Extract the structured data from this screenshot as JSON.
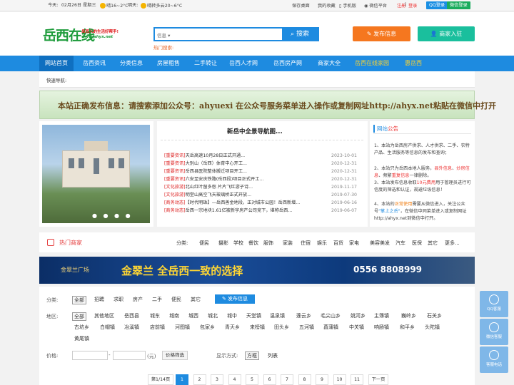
{
  "topbar": {
    "today_label": "今天:",
    "today_text": "02月26日 星期三",
    "weather_today": "晴16~2°C",
    "tomorrow_label": "明天:",
    "weather_tomorrow": "晴转多云20~6°C",
    "links": [
      "保存桌面",
      "我的收藏",
      "手机版",
      "微信平台"
    ],
    "register": "注册",
    "login": "登录",
    "qq_login": "QQ登录",
    "wechat_login": "微信登录"
  },
  "header": {
    "logo_text": "岳西在线",
    "logo_slogan": "岳西人的生活好帮手!",
    "logo_url": "www.ahyx.net",
    "search_select": "信息",
    "search_button": "搜索",
    "hot_search": "热门搜索:",
    "publish_button": "发布信息",
    "merchant_button": "商家入驻"
  },
  "nav": {
    "items": [
      "网站首页",
      "岳西资讯",
      "分类信息",
      "房屋租售",
      "二手转让",
      "岳西人才网",
      "岳西房产网",
      "商家大全",
      "岳西在线家园",
      "惠岳西"
    ]
  },
  "quick_nav": {
    "label": "快速导航:"
  },
  "banner1": {
    "text": "本站正确发布信息：请搜索添加公众号：ahyuexi  在公众号服务菜单进入操作或复制网址http://ahyx.net粘贴在微信中打开"
  },
  "news": {
    "title": "新岳中全景导航图...",
    "items": [
      {
        "cat": "[重要资讯]",
        "text": "天岳高速10月28日正式开通...",
        "date": "2023-10-01"
      },
      {
        "cat": "[重要资讯]",
        "text": "大别山（岳西）体育中心开工...",
        "date": "2020-12-31"
      },
      {
        "cat": "[重要资讯]",
        "text": "岳西县医院整体搬迁项目开工...",
        "date": "2020-12-31"
      },
      {
        "cat": "[重要资讯]",
        "text": "六安至安庆铁路(岳西段)项目正式开工...",
        "date": "2020-12-31"
      },
      {
        "cat": "[文化旅游]",
        "text": "北山红叶留多愁    片片飞红游子诗...",
        "date": "2019-11-17"
      },
      {
        "cat": "[文化旅游]",
        "text": "明堂山高空飞天玻璃桥正式开放...",
        "date": "2019-07-30"
      },
      {
        "cat": "[商务动态]",
        "text": "【时代明珠】—岳西善金地段，正对城市公园！岳西新增...",
        "date": "2019-06-16"
      },
      {
        "cat": "[商务动态]",
        "text": "岳西一宗地块1.61亿被新宇房产公司竞下，堪称岳西...",
        "date": "2019-06-07"
      }
    ]
  },
  "notice": {
    "title_a": "网站",
    "title_b": "公告",
    "lines": [
      {
        "parts": [
          {
            "t": "1、本站为岳西房产供求、人才供求、二手、农特产品、生活服务等信息的发布和查询；",
            "c": ""
          }
        ]
      },
      {
        "parts": [
          {
            "t": "2、本站只为岳西本地人服务，",
            "c": ""
          },
          {
            "t": "县外信息",
            "c": "r"
          },
          {
            "t": "、",
            "c": ""
          },
          {
            "t": "炒房信息",
            "c": "r"
          },
          {
            "t": "、频繁",
            "c": ""
          },
          {
            "t": "重复信息",
            "c": "r"
          },
          {
            "t": "一律删除。",
            "c": ""
          }
        ]
      },
      {
        "parts": [
          {
            "t": "3、本站发布信息收取",
            "c": ""
          },
          {
            "t": "10元费用",
            "c": "r"
          },
          {
            "t": "用于管理员进行可信度的筛选和认证，规避垃圾信息！",
            "c": ""
          }
        ]
      },
      {
        "parts": [
          {
            "t": "4、本站的",
            "c": ""
          },
          {
            "t": "正常使用",
            "c": "o"
          },
          {
            "t": "需要从微信进入，关注公众号",
            "c": ""
          },
          {
            "t": "\"掌上之岳\"",
            "c": "b"
          },
          {
            "t": "，在微信中同菜单进入或复制网址http://ahyx.net到微信中打开。",
            "c": ""
          }
        ]
      }
    ]
  },
  "shops": {
    "title": "热门商家",
    "categories": [
      "分类:",
      "便民",
      "摄影",
      "学校",
      "餐饮",
      "服饰",
      "家装",
      "住宿",
      "娱乐",
      "百货",
      "家电",
      "美容美发",
      "汽车",
      "医保",
      "其它",
      "更多..."
    ]
  },
  "banner2": {
    "brand": "金翠兰广场",
    "slogan": "金翠兰 全岳西一致的选择",
    "phone": "0556 8808999"
  },
  "filter": {
    "category_label": "分类:",
    "categories": [
      "全部",
      "招聘",
      "求职",
      "房产",
      "二手",
      "便民",
      "其它"
    ],
    "publish": "发布信息",
    "area_label": "地区:",
    "areas_row1": [
      "全部",
      "其他地区",
      "岳西县",
      "城东",
      "城南",
      "城西",
      "城北",
      "城中",
      "天堂镇",
      "温泉镇",
      "莲云乡",
      "毛尖山乡",
      "姚河乡",
      "主簿镇",
      "巍岭乡",
      "石关乡"
    ],
    "areas_row2": [
      "古坊乡",
      "白帽镇",
      "冶溪镇",
      "店前镇",
      "河图镇",
      "包家乡",
      "青天乡",
      "来榜镇",
      "田头乡",
      "五河镇",
      "菖蒲镇",
      "中关镇",
      "响肠镇",
      "和平乡",
      "头陀镇"
    ],
    "areas_row3": [
      "黄尾镇"
    ],
    "price_label": "价格:",
    "price_sep": "-",
    "price_unit": "(元)",
    "price_btn": "价格筛选",
    "display_label": "显示方式:",
    "display_box": "方框",
    "display_list": "列表"
  },
  "pagination": {
    "info": "第1/14页",
    "pages": [
      "1",
      "2",
      "3",
      "4",
      "5",
      "6",
      "7",
      "8",
      "9",
      "10",
      "11"
    ],
    "next": "下一页"
  },
  "side": {
    "qq": "QQ客服",
    "wechat": "微信客服",
    "phone": "客服电话"
  }
}
